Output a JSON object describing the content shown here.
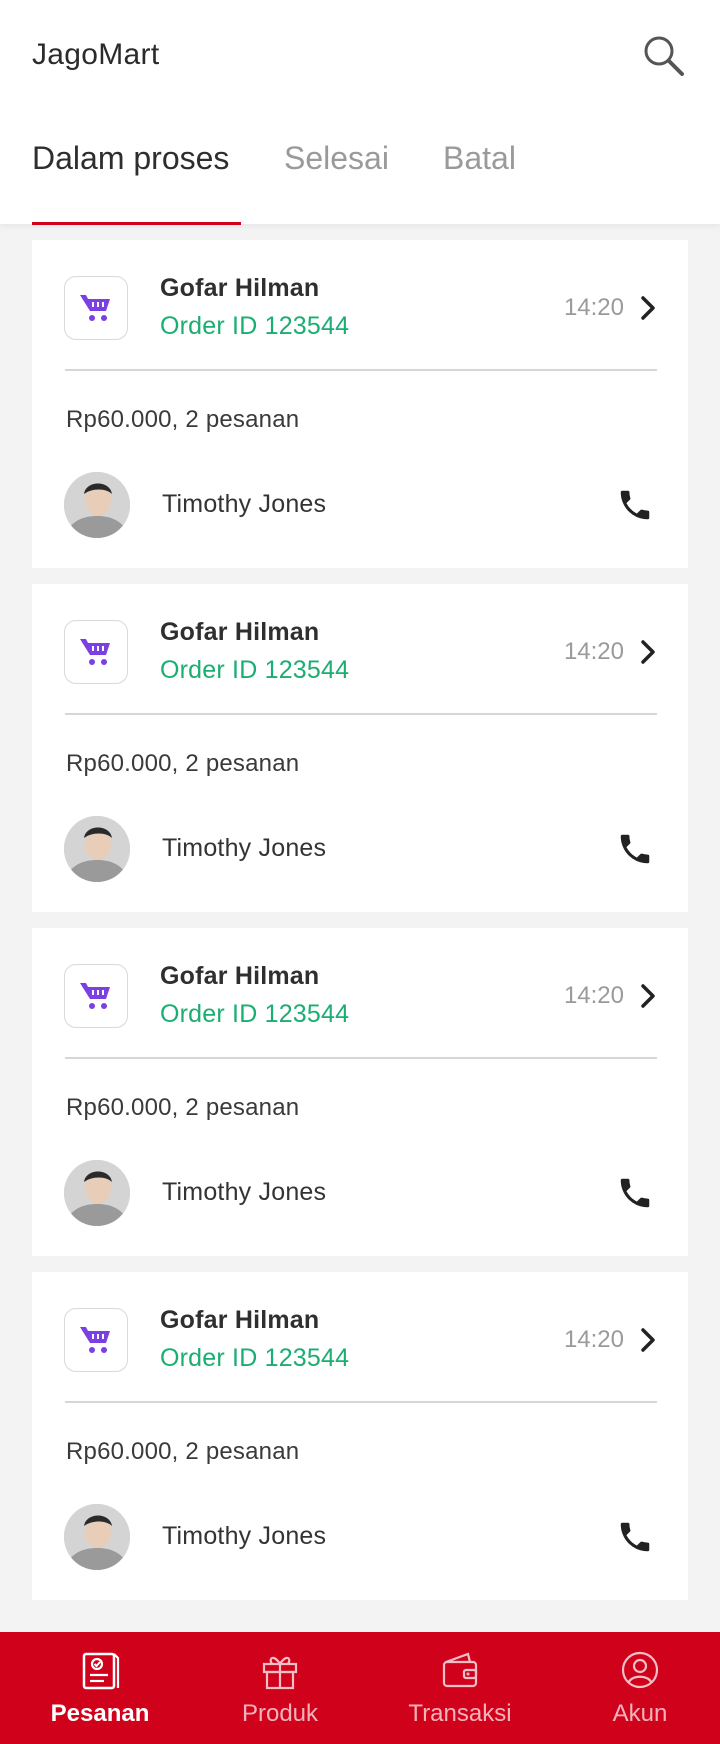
{
  "app": {
    "title": "JagoMart"
  },
  "tabs": [
    {
      "label": "Dalam proses",
      "active": true
    },
    {
      "label": "Selesai",
      "active": false
    },
    {
      "label": "Batal",
      "active": false
    }
  ],
  "orders": [
    {
      "store": "Gofar Hilman",
      "order_id": "Order ID 123544",
      "time": "14:20",
      "summary": "Rp60.000, 2 pesanan",
      "courier": "Timothy Jones"
    },
    {
      "store": "Gofar Hilman",
      "order_id": "Order ID 123544",
      "time": "14:20",
      "summary": "Rp60.000, 2 pesanan",
      "courier": "Timothy Jones"
    },
    {
      "store": "Gofar Hilman",
      "order_id": "Order ID 123544",
      "time": "14:20",
      "summary": "Rp60.000, 2 pesanan",
      "courier": "Timothy Jones"
    },
    {
      "store": "Gofar Hilman",
      "order_id": "Order ID 123544",
      "time": "14:20",
      "summary": "Rp60.000, 2 pesanan",
      "courier": "Timothy Jones"
    }
  ],
  "bottom_nav": [
    {
      "label": "Pesanan",
      "icon": "orders-icon",
      "active": true
    },
    {
      "label": "Produk",
      "icon": "gift-icon",
      "active": false
    },
    {
      "label": "Transaksi",
      "icon": "wallet-icon",
      "active": false
    },
    {
      "label": "Akun",
      "icon": "account-icon",
      "active": false
    }
  ],
  "colors": {
    "brand": "#d0021b",
    "order_id": "#1aae72",
    "store_icon": "#7b3fe4",
    "background": "#f3f3f4"
  }
}
